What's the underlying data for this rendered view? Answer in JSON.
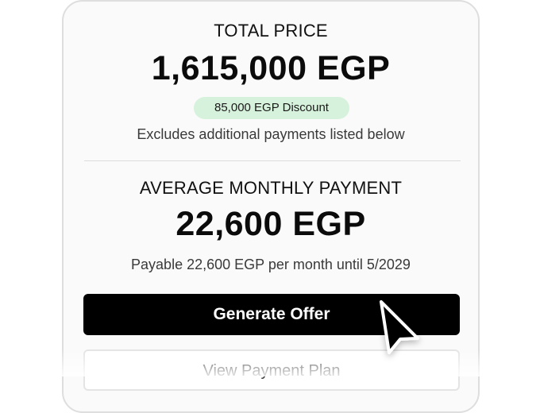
{
  "total": {
    "label": "TOTAL PRICE",
    "amount": "1,615,000 EGP",
    "discount_badge": "85,000 EGP Discount",
    "note": "Excludes additional payments listed below"
  },
  "monthly": {
    "label": "AVERAGE MONTHLY PAYMENT",
    "amount": "22,600 EGP",
    "note": "Payable 22,600 EGP per month until 5/2029"
  },
  "actions": {
    "generate_label": "Generate Offer",
    "view_plan_label": "View Payment Plan"
  },
  "colors": {
    "primary_button": "#000000",
    "discount_badge_bg": "#d7f2dc",
    "card_border": "#dedede"
  },
  "icons": {
    "cursor": "mouse-pointer-icon"
  }
}
